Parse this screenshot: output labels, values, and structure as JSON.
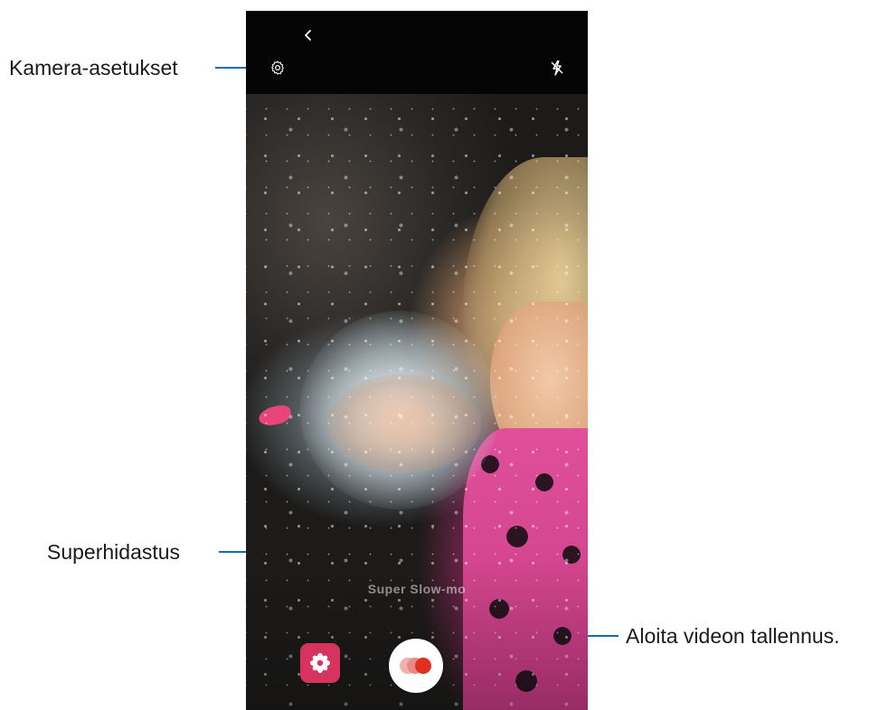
{
  "callouts": {
    "settings": "Kamera-asetukset",
    "super_slow_mo": "Superhidastus",
    "record": "Aloita videon tallennus."
  },
  "camera": {
    "mode_label": "Super Slow-mo"
  },
  "icons": {
    "back": "chevron-left-icon",
    "settings": "gear-icon",
    "flash": "flash-off-icon",
    "effects": "flower-effects-icon",
    "record": "record-super-slow-mo-icon"
  },
  "colors": {
    "leader": "#0d6fb3",
    "effects_button": "#d6345f",
    "record_dots": [
      "#f2b1ad",
      "#e98a85",
      "#e0301f"
    ]
  }
}
